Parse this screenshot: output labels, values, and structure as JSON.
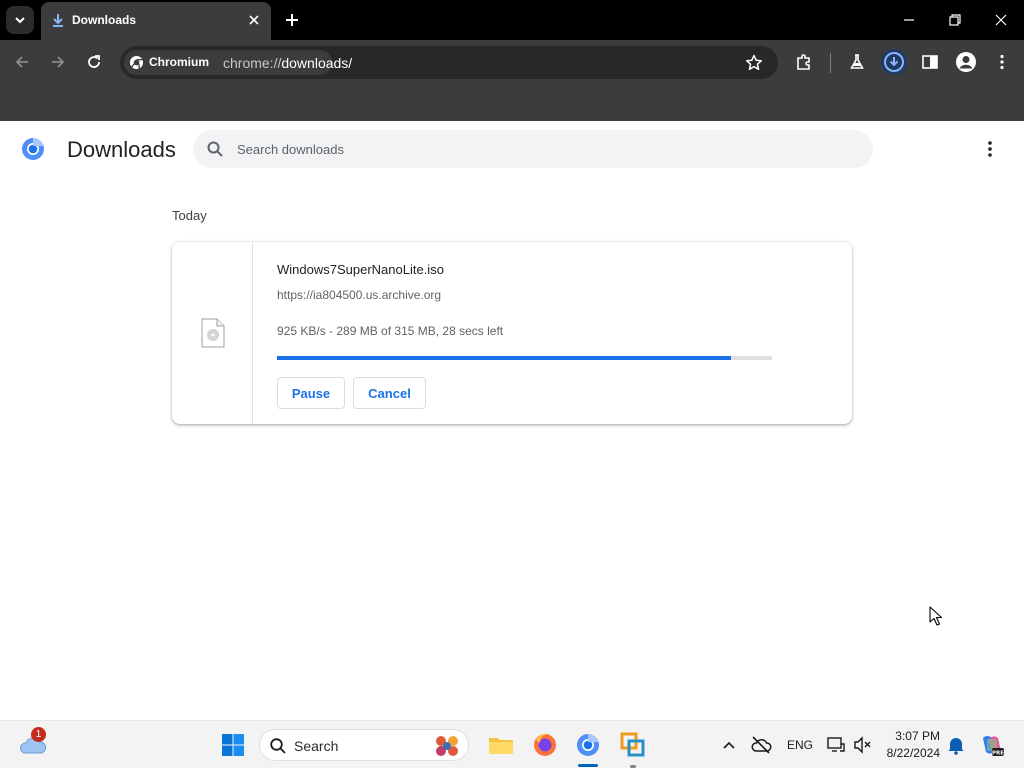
{
  "browser": {
    "tab": {
      "title": "Downloads",
      "favicon": "download-icon"
    },
    "site_chip": "Chromium",
    "url_scheme": "chrome://",
    "url_path": "downloads/",
    "colors": {
      "frame": "#000000",
      "toolbar": "#3c3c3c",
      "omnibox": "#282828"
    }
  },
  "page": {
    "title": "Downloads",
    "search_placeholder": "Search downloads",
    "section_label": "Today",
    "download": {
      "file_name": "Windows7SuperNanoLite.iso",
      "source_url": "https://ia804500.us.archive.org",
      "status": "925 KB/s - 289 MB of 315 MB, 28 secs left",
      "progress": 0.917,
      "pause_label": "Pause",
      "cancel_label": "Cancel"
    },
    "colors": {
      "accent": "#1a73e8",
      "track": "#e0e0e0"
    }
  },
  "taskbar": {
    "weather_badge": "1",
    "search_label": "Search",
    "language": "ENG",
    "time": "3:07 PM",
    "date": "8/22/2024",
    "apps": [
      "start-icon",
      "search-icon",
      "copilot-icon",
      "file-explorer-icon",
      "firefox-icon",
      "chromium-icon",
      "vmware-icon"
    ]
  }
}
